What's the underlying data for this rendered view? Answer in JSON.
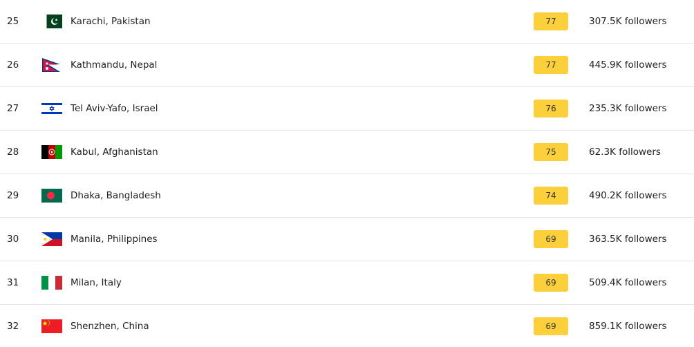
{
  "rows": [
    {
      "rank": "25",
      "city": "Karachi, Pakistan",
      "score": "77",
      "followers": "307.5K followers",
      "flag": "pakistan-flag-icon"
    },
    {
      "rank": "26",
      "city": "Kathmandu, Nepal",
      "score": "77",
      "followers": "445.9K followers",
      "flag": "nepal-flag-icon"
    },
    {
      "rank": "27",
      "city": "Tel Aviv-Yafo, Israel",
      "score": "76",
      "followers": "235.3K followers",
      "flag": "israel-flag-icon"
    },
    {
      "rank": "28",
      "city": "Kabul, Afghanistan",
      "score": "75",
      "followers": "62.3K followers",
      "flag": "afghanistan-flag-icon"
    },
    {
      "rank": "29",
      "city": "Dhaka, Bangladesh",
      "score": "74",
      "followers": "490.2K followers",
      "flag": "bangladesh-flag-icon"
    },
    {
      "rank": "30",
      "city": "Manila, Philippines",
      "score": "69",
      "followers": "363.5K followers",
      "flag": "philippines-flag-icon"
    },
    {
      "rank": "31",
      "city": "Milan, Italy",
      "score": "69",
      "followers": "509.4K followers",
      "flag": "italy-flag-icon"
    },
    {
      "rank": "32",
      "city": "Shenzhen, China",
      "score": "69",
      "followers": "859.1K followers",
      "flag": "china-flag-icon"
    }
  ],
  "colors": {
    "score_badge": "#fbd03a",
    "divider": "#e6e6e6"
  }
}
